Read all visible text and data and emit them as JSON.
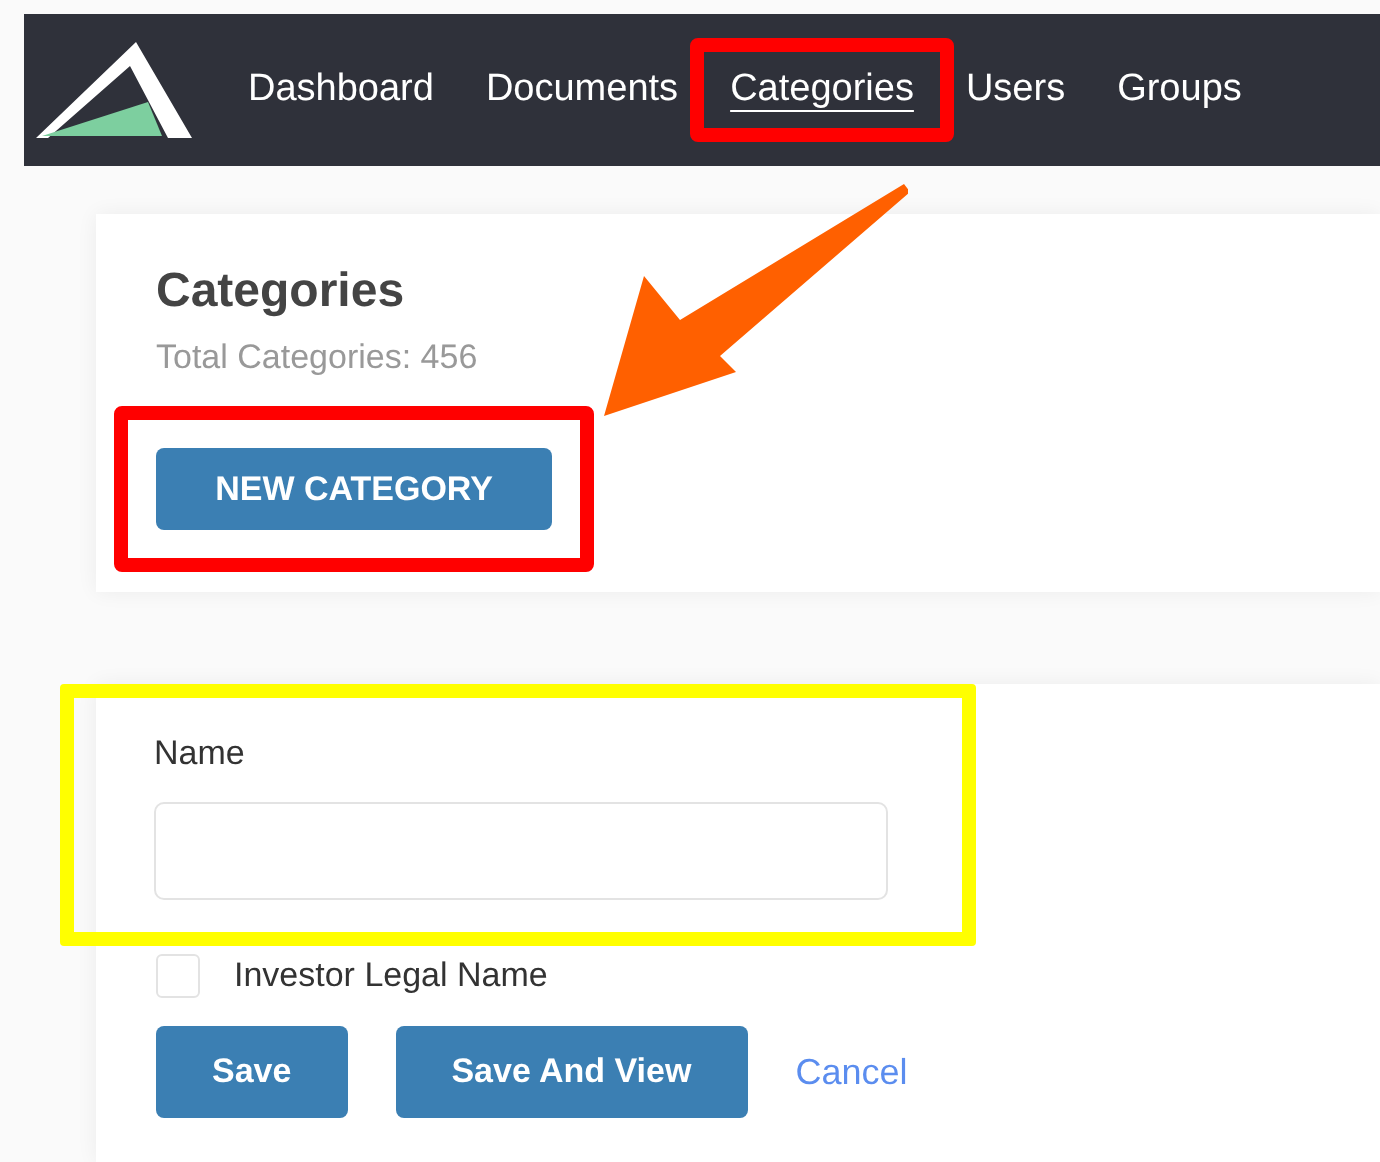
{
  "nav": {
    "items": [
      {
        "label": "Dashboard",
        "selected": false
      },
      {
        "label": "Documents",
        "selected": false
      },
      {
        "label": "Categories",
        "selected": true,
        "annotation": {
          "kind": "frame",
          "color": "#ff0000"
        }
      },
      {
        "label": "Users",
        "selected": false
      },
      {
        "label": "Groups",
        "selected": false
      }
    ]
  },
  "header_card": {
    "title": "Categories",
    "count": "Total Categories: 456",
    "button": {
      "label": "NEW CATEGORY",
      "annotation": {
        "kind": "frame",
        "color": "#ff0000"
      }
    }
  },
  "arrow": {
    "kind": "arrow",
    "color": "#ff6000"
  },
  "form": {
    "name_field": {
      "label": "Name",
      "annotation": {
        "kind": "frame",
        "color": "#ffff00"
      }
    },
    "checkbox": {
      "label": "Investor Legal Name",
      "checked": false
    },
    "buttons": [
      {
        "label": "Save",
        "kind": "button"
      },
      {
        "label": "Save And View",
        "kind": "button"
      },
      {
        "label": "Cancel",
        "kind": "link"
      }
    ]
  }
}
